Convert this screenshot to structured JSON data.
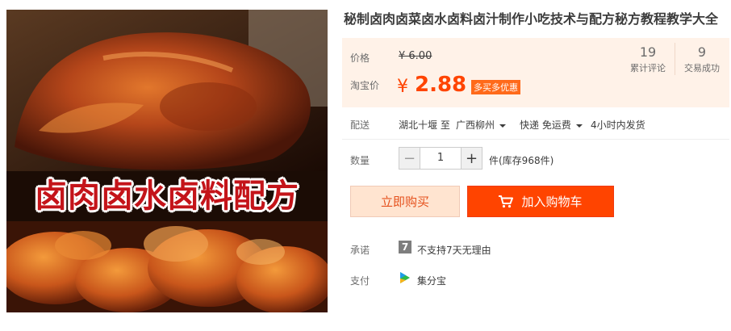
{
  "product": {
    "title": "秘制卤肉卤菜卤水卤料卤汁制作小吃技术与配方秘方教程教学大全",
    "image_banner_text": "卤肉卤水卤料配方"
  },
  "price": {
    "original_label": "价格",
    "original_value": "¥ 6.00",
    "current_label": "淘宝价",
    "currency": "¥",
    "current_value": "2.88",
    "promo_badge": "多买多优惠"
  },
  "stats": [
    {
      "value": "19",
      "label": "累计评论"
    },
    {
      "value": "9",
      "label": "交易成功"
    }
  ],
  "delivery": {
    "label": "配送",
    "from": "湖北十堰 至",
    "to": "广西柳州",
    "method": "快递 免运费",
    "ship_time": "4小时内发货"
  },
  "quantity": {
    "label": "数量",
    "minus": "−",
    "value": "1",
    "plus": "+",
    "stock": "件(库存968件)"
  },
  "actions": {
    "buy_now": "立即购买",
    "add_cart": "加入购物车"
  },
  "promise": {
    "label": "承诺",
    "icon_glyph": "7",
    "text": "不支持7天无理由"
  },
  "payment": {
    "label": "支付",
    "icon": "jifenbao-icon",
    "text": "集分宝"
  },
  "colors": {
    "accent": "#ff4400",
    "price_bg": "#fff2e8",
    "buy_now_bg": "#ffe4d0"
  }
}
